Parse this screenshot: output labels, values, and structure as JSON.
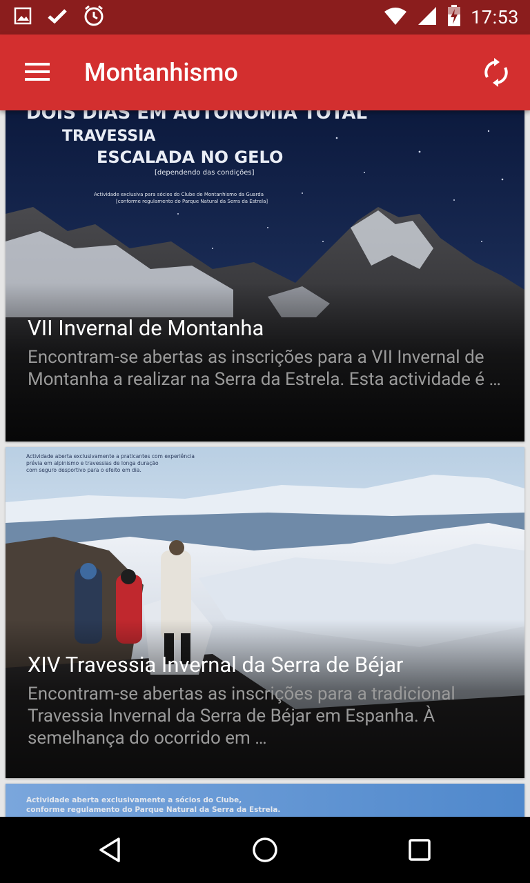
{
  "status_bar": {
    "time": "17:53",
    "left_icons": [
      "image-icon",
      "check-icon",
      "alarm-icon"
    ],
    "right_icons": [
      "wifi-icon",
      "signal-icon",
      "battery-charging-icon"
    ]
  },
  "app_bar": {
    "title": "Montanhismo",
    "menu_icon": "menu-icon",
    "refresh_icon": "refresh-icon",
    "color": "#d32f2f",
    "status_color": "#8b1d1d"
  },
  "posts": [
    {
      "title": "VII Invernal de Montanha",
      "excerpt": "  Encontram-se abertas as inscrições para a VII Invernal de Montanha a realizar na Serra da Estrela. Esta actividade é …",
      "image_text": {
        "line1": "DOIS DIAS EM AUTONOMIA TOTAL",
        "line2": "TRAVESSIA",
        "line3": "ESCALADA NO GELO",
        "line4": "[dependendo das condições]",
        "line5": "Actividade exclusiva para sócios do Clube de Montanhismo da Guarda",
        "line6": "[conforme regulamento do Parque Natural da Serra da Estrela]"
      }
    },
    {
      "title": "XIV Travessia Invernal da Serra de Béjar",
      "excerpt": "Encontram-se abertas as inscrições para a tradicional Travessia Invernal da Serra de Béjar em Espanha. À semelhança do ocorrido em …",
      "image_text": {
        "line1": "Actividade aberta exclusivamente a praticantes com experiência",
        "line2": "prévia em alpinismo e travessias de longa duração",
        "line3": "com seguro desportivo para o efeito em dia."
      }
    },
    {
      "title": "",
      "excerpt": "",
      "image_text": {
        "line1": "Actividade aberta exclusivamente a sócios do Clube,",
        "line2": "conforme regulamento do Parque Natural da Serra da Estrela."
      }
    }
  ],
  "nav_bar": {
    "icons": [
      "back-icon",
      "home-icon",
      "recents-icon"
    ]
  }
}
